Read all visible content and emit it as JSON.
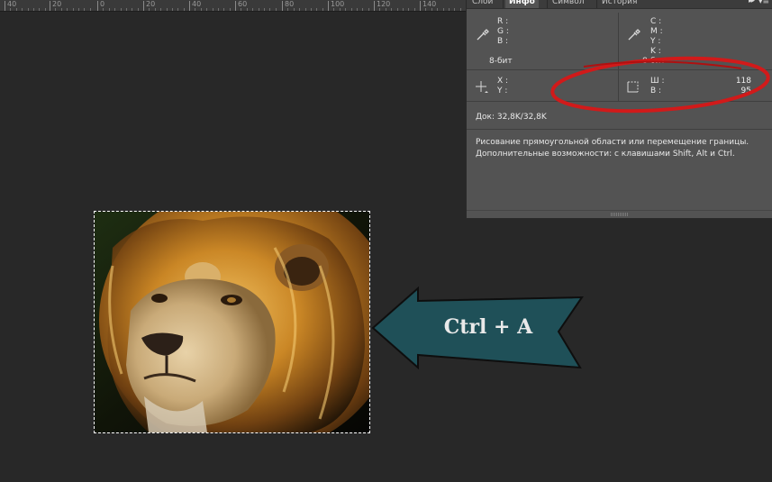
{
  "ruler": {
    "labels": [
      "40",
      "20",
      "0",
      "20",
      "40",
      "60",
      "80",
      "100",
      "120",
      "140"
    ]
  },
  "panel": {
    "tabs": [
      "Слои",
      "Инфо",
      "Символ",
      "История"
    ],
    "active_tab": "Инфо",
    "menu_icon": "panel-menu-icon",
    "rgb": {
      "r": "R :",
      "g": "G :",
      "b": "B :"
    },
    "cmyk": {
      "c": "C :",
      "m": "M :",
      "y": "Y :",
      "k": "K :"
    },
    "bit_left": "8-бит",
    "bit_right": "8-бит",
    "xy": {
      "x": "X :",
      "y": "Y :"
    },
    "size": {
      "w_label": "Ш :",
      "h_label": "В :",
      "w_value": "118",
      "h_value": "95"
    },
    "doc": "Док: 32,8K/32,8K",
    "hint_line1": "Рисование прямоугольной области или перемещение границы.",
    "hint_line2": "Дополнительные возможности: с клавишами Shift, Alt и Ctrl."
  },
  "callout": {
    "text": "Ctrl + A",
    "fill": "#1f5058"
  },
  "colors": {
    "canvas_bg": "#282828",
    "panel_bg": "#535353",
    "annotation_red": "#d11a1a"
  }
}
